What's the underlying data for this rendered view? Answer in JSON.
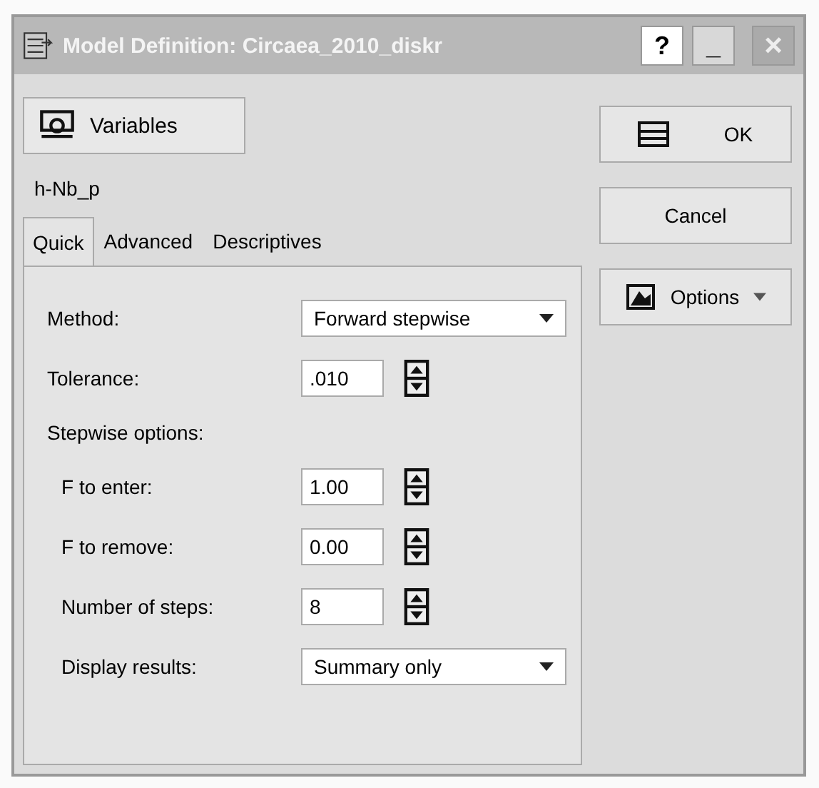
{
  "window": {
    "title": "Model Definition: Circaea_2010_diskr",
    "help": "?",
    "minimize": "_",
    "close": "×"
  },
  "variables_button": "Variables",
  "dependent": "h-Nb_p",
  "tabs": [
    {
      "label": "Quick",
      "selected": true
    },
    {
      "label": "Advanced",
      "selected": false
    },
    {
      "label": "Descriptives",
      "selected": false
    }
  ],
  "fields": [
    {
      "kind": "dropdown",
      "label": "Method:",
      "value": "Forward stepwise"
    },
    {
      "kind": "spinner",
      "label": "Tolerance:",
      "value": ".010"
    },
    {
      "kind": "heading",
      "label": "Stepwise options:"
    },
    {
      "kind": "spinner",
      "label": "F to enter:",
      "value": "1.00",
      "indent": true
    },
    {
      "kind": "spinner",
      "label": "F to remove:",
      "value": "0.00",
      "indent": true
    },
    {
      "kind": "spinner",
      "label": "Number of steps:",
      "value": "8",
      "indent": true
    },
    {
      "kind": "dropdown",
      "label": "Display results:",
      "value": "Summary only",
      "indent": true
    }
  ],
  "buttons": [
    {
      "kind": "ok",
      "label": "OK"
    },
    {
      "kind": "plain",
      "label": "Cancel"
    },
    {
      "kind": "menu",
      "label": "Options"
    }
  ]
}
